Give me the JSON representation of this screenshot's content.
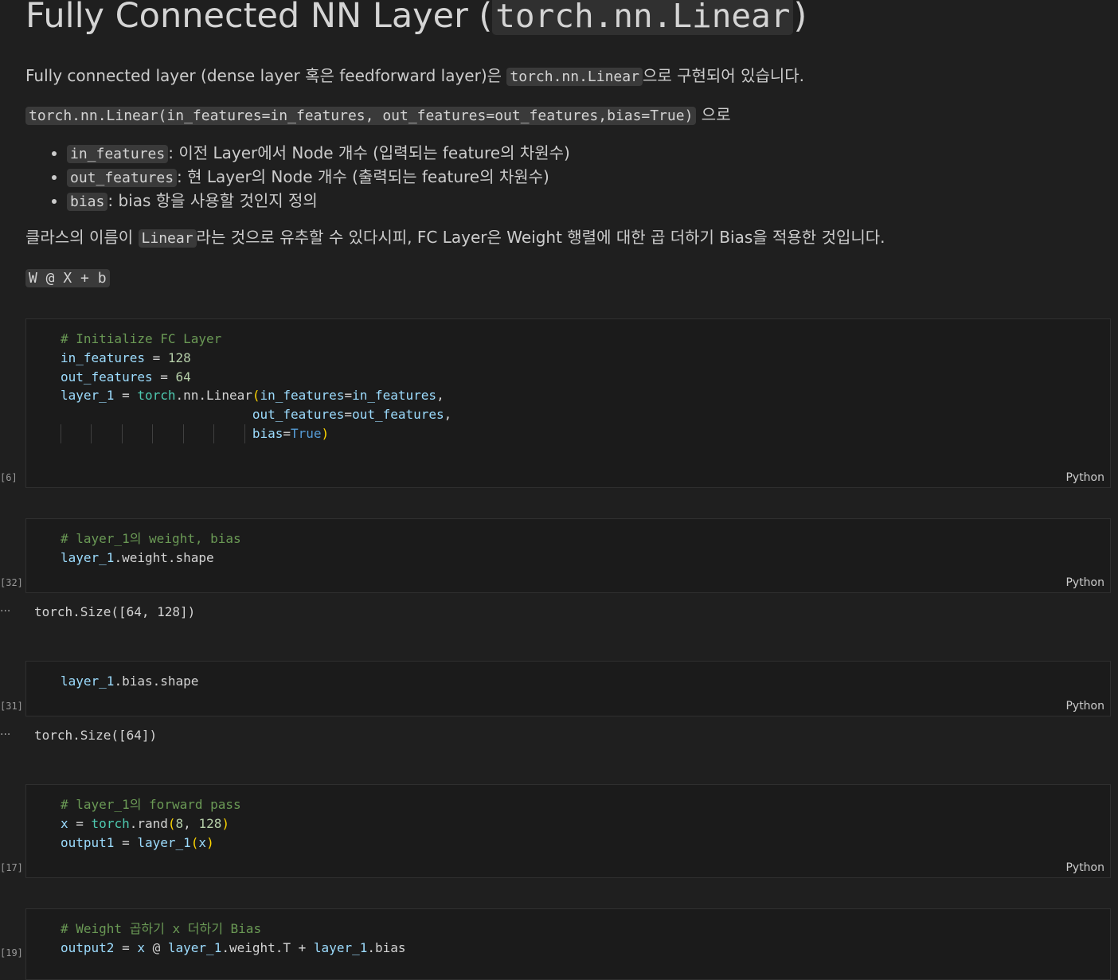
{
  "title": {
    "text": "Fully Connected NN Layer (",
    "code": "torch.nn.Linear",
    "close": ")"
  },
  "para1": {
    "pre": "Fully connected layer (dense layer 혹은 feedforward layer)은 ",
    "code": "torch.nn.Linear",
    "post": "으로 구현되어 있습니다."
  },
  "para2": {
    "code": "torch.nn.Linear(in_features=in_features, out_features=out_features,bias=True)",
    "post": " 으로"
  },
  "bullets": [
    {
      "code": "in_features",
      "text": ": 이전 Layer에서 Node 개수 (입력되는 feature의 차원수)"
    },
    {
      "code": "out_features",
      "text": ": 현 Layer의 Node 개수 (출력되는 feature의 차원수)"
    },
    {
      "code": "bias",
      "text": ": bias 항을 사용할 것인지 정의"
    }
  ],
  "para3": {
    "pre": "클라스의 이름이 ",
    "code": "Linear",
    "post": "라는 것으로 유추할 수 있다시피, FC Layer은 Weight 행렬에 대한 곱 더하기 Bias을 적용한 것입니다."
  },
  "formula": "W @ X + b",
  "cells": [
    {
      "exec": "[6]",
      "lang": "Python"
    },
    {
      "exec": "[32]",
      "lang": "Python",
      "output": "torch.Size([64, 128])"
    },
    {
      "exec": "[31]",
      "lang": "Python",
      "output": "torch.Size([64])"
    },
    {
      "exec": "[17]",
      "lang": "Python"
    },
    {
      "exec": "[19]"
    }
  ],
  "code": {
    "c1": {
      "l1": "# Initialize FC Layer",
      "l2a": "in_features",
      "l2b": " = ",
      "l2c": "128",
      "l3a": "out_features",
      "l3b": " = ",
      "l3c": "64",
      "l4a": "layer_1",
      "l4b": " = ",
      "l4c": "torch",
      "l4d": ".nn.Linear",
      "l4e": "(",
      "l4f": "in_features",
      "l4g": "=",
      "l4h": "in_features",
      "l4i": ",",
      "l5a": "out_features",
      "l5b": "=",
      "l5c": "out_features",
      "l5d": ",",
      "l6a": "bias",
      "l6b": "=",
      "l6c": "True",
      "l6d": ")"
    },
    "c2": {
      "l1": "# layer_1의 weight, bias",
      "l2a": "layer_1",
      "l2b": ".weight.shape"
    },
    "c3": {
      "l1a": "layer_1",
      "l1b": ".bias.shape"
    },
    "c4": {
      "l1": "# layer_1의 forward pass",
      "l2a": "x",
      "l2b": " = ",
      "l2c": "torch",
      "l2d": ".rand",
      "l2e": "(",
      "l2f": "8",
      "l2g": ", ",
      "l2h": "128",
      "l2i": ")",
      "l3a": "output1",
      "l3b": " = ",
      "l3c": "layer_1",
      "l3d": "(",
      "l3e": "x",
      "l3f": ")"
    },
    "c5": {
      "l1": "# Weight 곱하기 x 더하기 Bias",
      "l2a": "output2",
      "l2b": " = ",
      "l2c": "x",
      "l2d": " @ ",
      "l2e": "layer_1",
      "l2f": ".weight.T + ",
      "l2g": "layer_1",
      "l2h": ".bias"
    }
  },
  "output_indicator": "···"
}
